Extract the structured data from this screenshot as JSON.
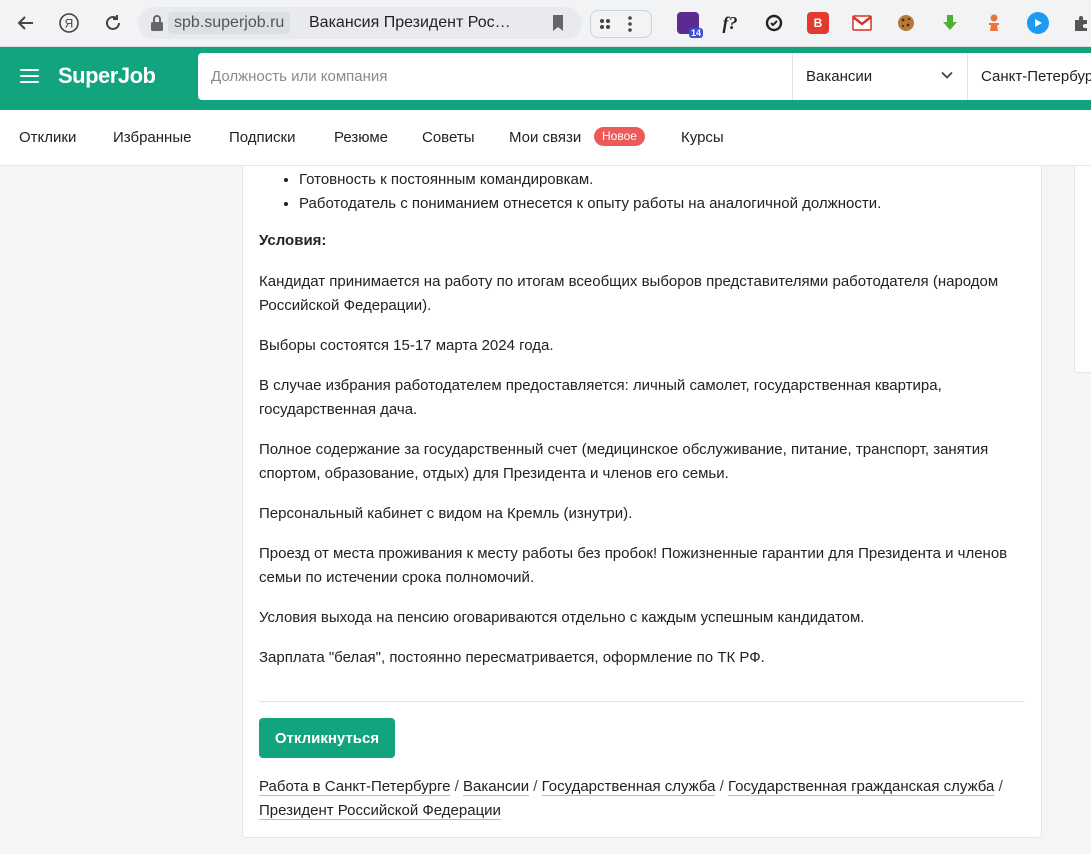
{
  "browser": {
    "url_host": "spb.superjob.ru",
    "tab_title": "Вакансия Президент Рос…",
    "ext_badge": "14",
    "ext_f": "f?"
  },
  "header": {
    "logo": "SuperJob",
    "search_placeholder": "Должность или компания",
    "type_select": "Вакансии",
    "city": "Санкт-Петербург"
  },
  "subnav": {
    "items": [
      "Отклики",
      "Избранные",
      "Подписки",
      "Резюме",
      "Советы",
      "Мои связи",
      "Курсы"
    ],
    "badge": "Новое"
  },
  "vacancy": {
    "requirements": [
      "Готовность к постоянным командировкам.",
      "Работодатель с пониманием отнесется к опыту работы на аналогичной должности."
    ],
    "conditions_heading": "Условия:",
    "paragraphs": [
      "Кандидат принимается на работу по итогам всеобщих выборов представителями работодателя (народом Российской Федерации).",
      "Выборы состоятся 15-17 марта 2024 года.",
      "В случае избрания работодателем предоставляется: личный самолет, государственная квартира, государственная дача.",
      "Полное содержание за государственный счет (медицинское обслуживание, питание, транспорт, занятия спортом, образование, отдых) для Президента и членов его семьи.",
      "Персональный кабинет с видом на Кремль (изнутри).",
      "Проезд от места проживания к месту работы без пробок! Пожизненные гарантии для Президента и членов семьи по истечении срока полномочий.",
      "Условия выхода на пенсию оговариваются отдельно с каждым успешным кандидатом.",
      "Зарплата \"белая\", постоянно пересматривается, оформление по ТК РФ."
    ],
    "apply_label": "Откликнуться",
    "breadcrumbs": [
      "Работа в Санкт-Петербурге",
      "Вакансии",
      "Государственная служба",
      "Государственная гражданская служба",
      "Президент Российской Федерации"
    ]
  }
}
